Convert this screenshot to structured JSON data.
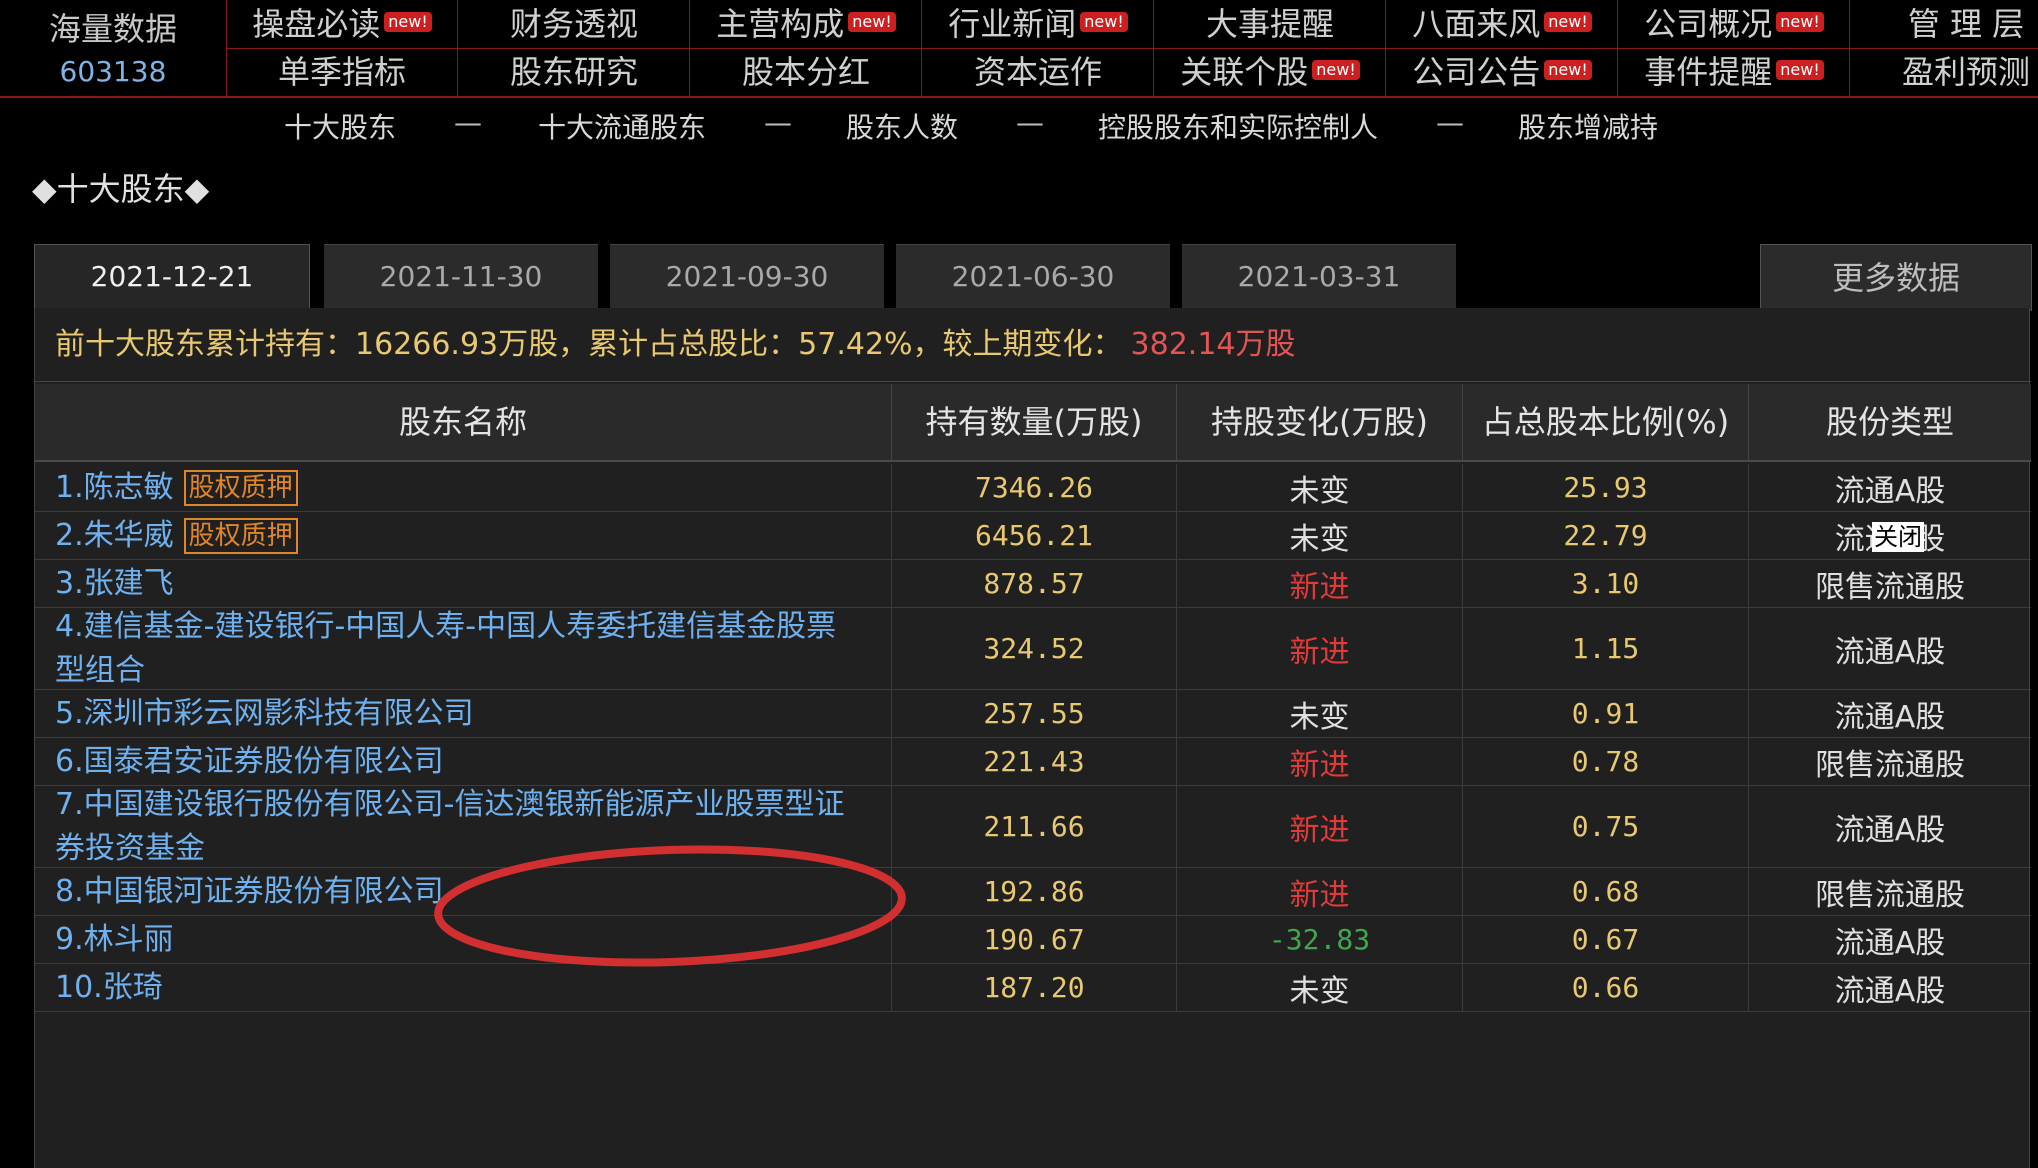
{
  "brand": {
    "name": "海量数据",
    "code": "603138"
  },
  "nav": {
    "new_label": "new!",
    "columns": [
      {
        "top": "操盘必读",
        "top_new": true,
        "bottom": "单季指标",
        "bottom_new": false
      },
      {
        "top": "财务透视",
        "top_new": false,
        "bottom": "股东研究",
        "bottom_new": false
      },
      {
        "top": "主营构成",
        "top_new": true,
        "bottom": "股本分红",
        "bottom_new": false
      },
      {
        "top": "行业新闻",
        "top_new": true,
        "bottom": "资本运作",
        "bottom_new": false
      },
      {
        "top": "大事提醒",
        "top_new": false,
        "bottom": "关联个股",
        "bottom_new": true
      },
      {
        "top": "八面来风",
        "top_new": true,
        "bottom": "公司公告",
        "bottom_new": true
      },
      {
        "top": "公司概况",
        "top_new": true,
        "bottom": "事件提醒",
        "bottom_new": true
      },
      {
        "top": "管 理 层",
        "top_new": false,
        "bottom": "盈利预测",
        "bottom_new": false
      }
    ]
  },
  "subnav": {
    "items": [
      "十大股东",
      "十大流通股东",
      "股东人数",
      "控股股东和实际控制人",
      "股东增减持"
    ],
    "separator": "—"
  },
  "section_title": "◆十大股东◆",
  "tabs": [
    "2021-12-21",
    "2021-11-30",
    "2021-09-30",
    "2021-06-30",
    "2021-03-31"
  ],
  "active_tab": 0,
  "more_label": "更多数据",
  "summary": {
    "text": "前十大股东累计持有：16266.93万股，累计占总股比：57.42%，较上期变化：",
    "change": "382.14万股"
  },
  "table": {
    "headers": [
      "股东名称",
      "持有数量(万股)",
      "持股变化(万股)",
      "占总股本比例(%)",
      "股份类型"
    ],
    "pledge_label": "股权质押",
    "rows": [
      {
        "name": "1.陈志敏",
        "pledge": true,
        "qty": "7346.26",
        "change": "未变",
        "change_kind": "same",
        "pct": "25.93",
        "type": "流通A股"
      },
      {
        "name": "2.朱华威",
        "pledge": true,
        "qty": "6456.21",
        "change": "未变",
        "change_kind": "same",
        "pct": "22.79",
        "type": "流通A股"
      },
      {
        "name": "3.张建飞",
        "pledge": false,
        "qty": "878.57",
        "change": "新进",
        "change_kind": "new",
        "pct": "3.10",
        "type": "限售流通股"
      },
      {
        "name": "4.建信基金-建设银行-中国人寿-中国人寿委托建信基金股票型组合",
        "pledge": false,
        "qty": "324.52",
        "change": "新进",
        "change_kind": "new",
        "pct": "1.15",
        "type": "流通A股"
      },
      {
        "name": "5.深圳市彩云网影科技有限公司",
        "pledge": false,
        "qty": "257.55",
        "change": "未变",
        "change_kind": "same",
        "pct": "0.91",
        "type": "流通A股"
      },
      {
        "name": "6.国泰君安证券股份有限公司",
        "pledge": false,
        "qty": "221.43",
        "change": "新进",
        "change_kind": "new",
        "pct": "0.78",
        "type": "限售流通股"
      },
      {
        "name": "7.中国建设银行股份有限公司-信达澳银新能源产业股票型证券投资基金",
        "pledge": false,
        "qty": "211.66",
        "change": "新进",
        "change_kind": "new",
        "pct": "0.75",
        "type": "流通A股"
      },
      {
        "name": "8.中国银河证券股份有限公司",
        "pledge": false,
        "qty": "192.86",
        "change": "新进",
        "change_kind": "new",
        "pct": "0.68",
        "type": "限售流通股"
      },
      {
        "name": "9.林斗丽",
        "pledge": false,
        "qty": "190.67",
        "change": "-32.83",
        "change_kind": "down",
        "pct": "0.67",
        "type": "流通A股"
      },
      {
        "name": "10.张琦",
        "pledge": false,
        "qty": "187.20",
        "change": "未变",
        "change_kind": "same",
        "pct": "0.66",
        "type": "流通A股"
      }
    ]
  },
  "close_tip": "关闭",
  "colors": {
    "nav_border": "#8b1818",
    "new_badge": "#cc1f1f",
    "holder_name": "#6fb0ee",
    "value_gold": "#e8c870",
    "new_entry_red": "#e03a3a",
    "decrease_green": "#3fa84a",
    "pledge_orange": "#e0862a",
    "annotation_circle": "#d23030"
  }
}
